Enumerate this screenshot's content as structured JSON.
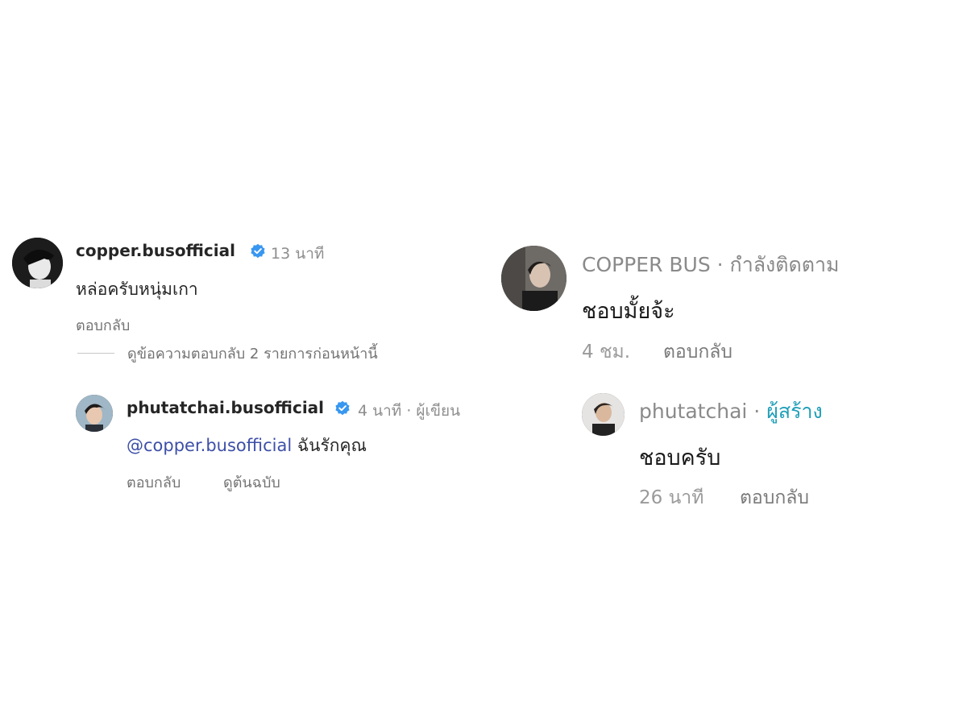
{
  "instagram": {
    "comment": {
      "username": "copper.busofficial",
      "time": "13 นาที",
      "text": "หล่อครับหนุ่มเกา",
      "reply_label": "ตอบกลับ",
      "avatar_icon": "profile-photo-grayscale"
    },
    "view_replies": "ดูข้อความตอบกลับ 2 รายการก่อนหน้านี้",
    "reply": {
      "username": "phutatchai.busofficial",
      "time": "4 นาที · ผู้เขียน",
      "mention": "@copper.busofficial",
      "text": " ฉันรักคุณ",
      "reply_label": "ตอบกลับ",
      "see_original": "ดูต้นฉบับ",
      "avatar_icon": "profile-photo"
    },
    "verified_icon": "verified-badge-icon",
    "colors": {
      "verified": "#3897f0",
      "mention": "#3d4fa8",
      "secondary_text": "#737373"
    }
  },
  "tiktok": {
    "comment": {
      "name": "COPPER BUS",
      "status": " · กำลังติดตาม",
      "text": "ชอบมั้ยจ้ะ",
      "time": "4 ชม.",
      "reply_label": "ตอบกลับ",
      "avatar_icon": "profile-photo"
    },
    "reply": {
      "name": "phutatchai",
      "separator": " · ",
      "creator_label": "ผู้สร้าง",
      "text": "ชอบครับ",
      "time": "26 นาที",
      "reply_label": "ตอบกลับ",
      "avatar_icon": "profile-photo"
    },
    "colors": {
      "creator": "#1f9fb8",
      "name": "#8a8a8a"
    }
  }
}
